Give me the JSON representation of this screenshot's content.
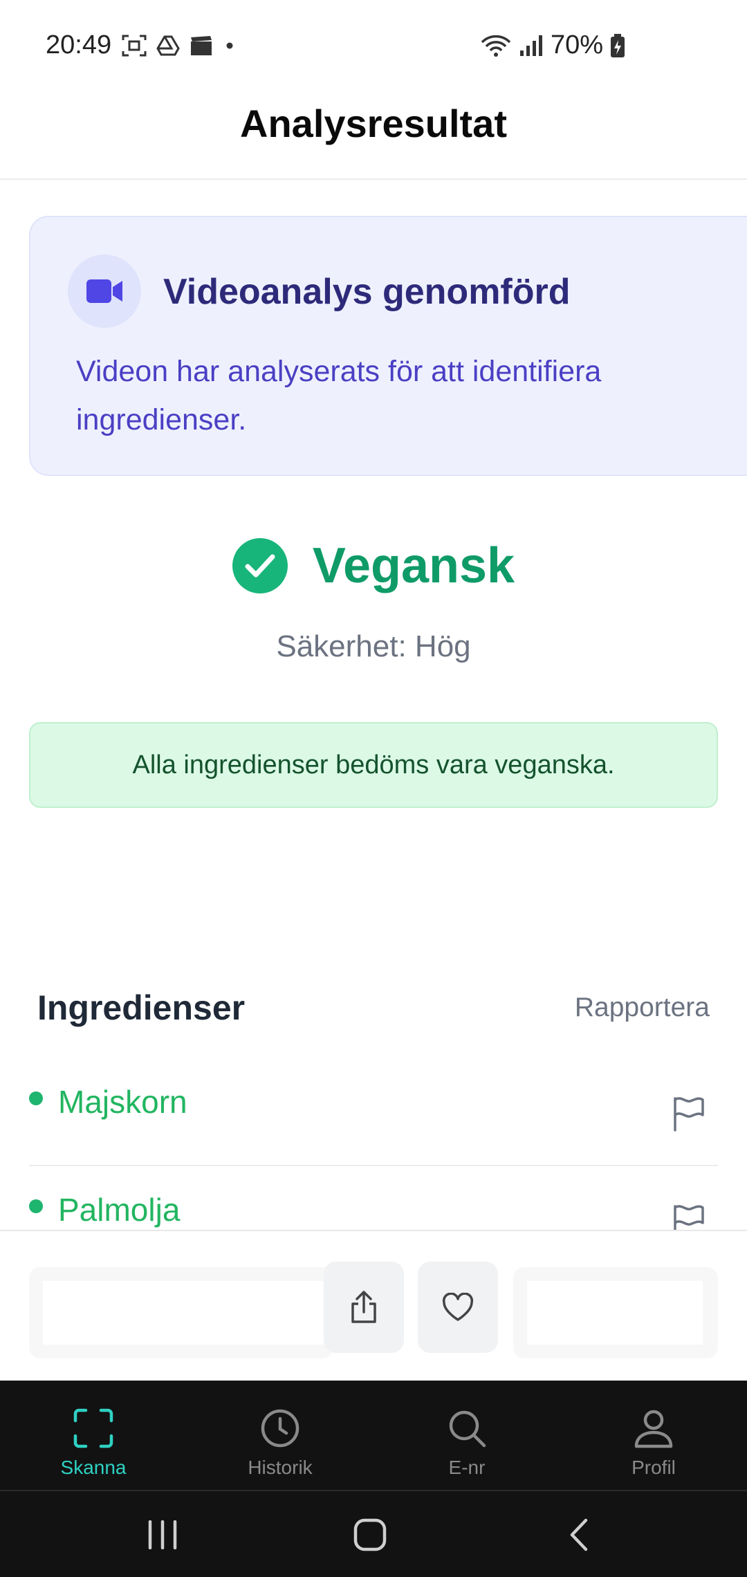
{
  "status_bar": {
    "time": "20:49",
    "battery": "70%"
  },
  "app_bar": {
    "title": "Analysresultat"
  },
  "video_card": {
    "icon": "video-camera-icon",
    "title": "Videoanalys genomförd",
    "description": "Videon har analyserats för att identifiera ingredienser."
  },
  "verdict": {
    "label": "Vegansk",
    "confidence": "Säkerhet: Hög",
    "color": "#0f9b68"
  },
  "note": {
    "text": "Alla ingredienser bedöms vara veganska."
  },
  "ingredients": {
    "heading": "Ingredienser",
    "report_link": "Rapportera",
    "items": [
      {
        "name": "Majskorn"
      },
      {
        "name": "Palmolja"
      }
    ]
  },
  "actions": {
    "share_icon": "share-icon",
    "favorite_icon": "heart-icon"
  },
  "tabs": [
    {
      "label": "Skanna",
      "icon": "scan-icon",
      "active": true
    },
    {
      "label": "Historik",
      "icon": "clock-icon",
      "active": false
    },
    {
      "label": "E-nr",
      "icon": "search-icon",
      "active": false
    },
    {
      "label": "Profil",
      "icon": "user-icon",
      "active": false
    }
  ],
  "colors": {
    "accent": "#2fd1c3",
    "vegan_green": "#18b57a",
    "video_card_bg": "#eef1fd"
  }
}
